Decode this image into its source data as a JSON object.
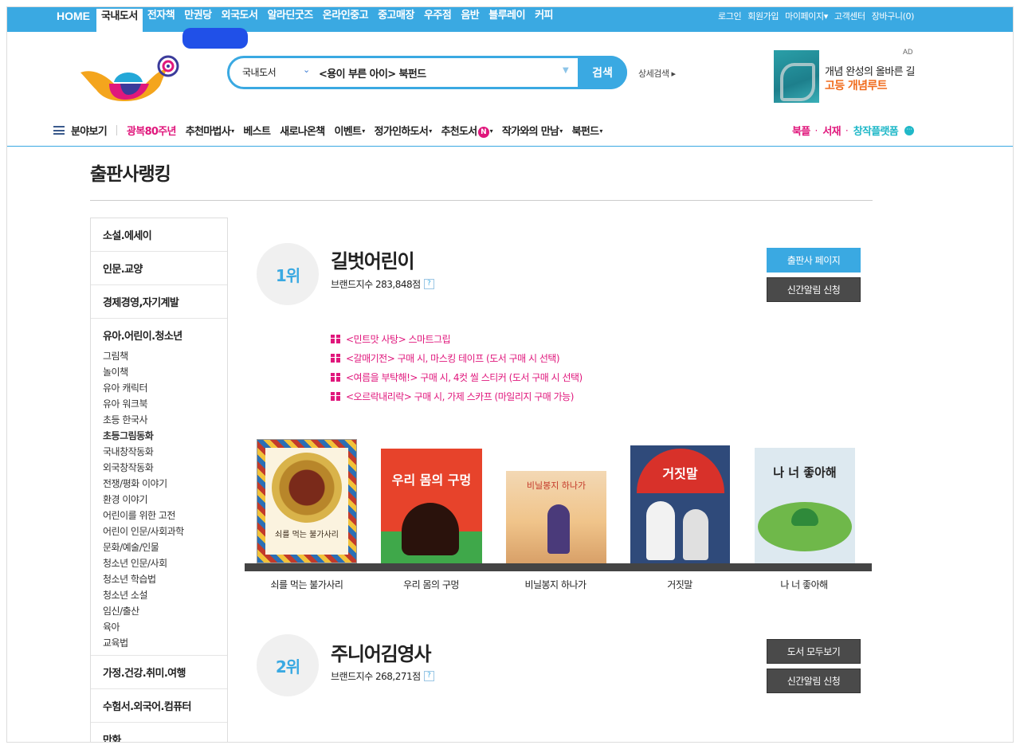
{
  "top_nav": {
    "items": [
      {
        "label": "HOME"
      },
      {
        "label": "국내도서"
      },
      {
        "label": "전자책"
      },
      {
        "label": "만권당"
      },
      {
        "label": "외국도서"
      },
      {
        "label": "알라딘굿즈"
      },
      {
        "label": "온라인중고"
      },
      {
        "label": "중고매장"
      },
      {
        "label": "우주점"
      },
      {
        "label": "음반"
      },
      {
        "label": "블루레이"
      },
      {
        "label": "커피"
      }
    ],
    "active": "국내도서",
    "util": [
      "로그인",
      "회원가입",
      "마이페이지▾",
      "고객센터",
      "장바구니(0)"
    ]
  },
  "search": {
    "category": "국내도서",
    "query": "<용이 부른 아이> 북펀드",
    "button_label": "검색",
    "advanced_label": "상세검색 ▸"
  },
  "ad": {
    "label": "AD",
    "line1": "개념 완성의 올바른 길",
    "line2": "고등 개념루트"
  },
  "gnb": {
    "menu_label": "분야보기",
    "items": [
      {
        "label": "광복80주년",
        "caret": ""
      },
      {
        "label": "추천마법사",
        "caret": "▾"
      },
      {
        "label": "베스트",
        "caret": ""
      },
      {
        "label": "새로나온책",
        "caret": ""
      },
      {
        "label": "이벤트",
        "caret": "▾"
      },
      {
        "label": "정가인하도서",
        "caret": "▾"
      },
      {
        "label": "추천도서",
        "caret": "▾"
      },
      {
        "label": "작가와의 만남",
        "caret": "▾"
      },
      {
        "label": "북펀드",
        "caret": "▾"
      }
    ],
    "new_badge": "N",
    "right": [
      {
        "label": "북플",
        "color": "#e0177c"
      },
      {
        "label": "서재",
        "color": "#e0177c"
      },
      {
        "label": "창작플랫폼",
        "color": "#20b8c8"
      }
    ],
    "dot": "·",
    "more_icon": "···"
  },
  "page_title": "출판사랭킹",
  "sidebar": {
    "categories": [
      {
        "label": "소설.에세이"
      },
      {
        "label": "인문.교양"
      },
      {
        "label": "경제경영,자기계발"
      },
      {
        "label": "유아.어린이.청소년",
        "subs": [
          "그림책",
          "놀이책",
          "유아 캐릭터",
          "유아 워크북",
          "초등 한국사",
          "초등그림동화",
          "국내창작동화",
          "외국창작동화",
          "전쟁/평화 이야기",
          "환경 이야기",
          "어린이를 위한 고전",
          "어린이 인문/사회과학",
          "문화/예술/인물",
          "청소년 인문/사회",
          "청소년 학습법",
          "청소년 소설",
          "임신/출산",
          "육아",
          "교육법"
        ],
        "bold_sub": "초등그림동화"
      },
      {
        "label": "가정.건강.취미.여행"
      },
      {
        "label": "수험서.외국어.컴퓨터"
      },
      {
        "label": "만화"
      }
    ]
  },
  "rankings": [
    {
      "rank": "1위",
      "name": "길벗어린이",
      "brand_index": "브랜드지수 283,848점",
      "help": "?",
      "buttons": [
        "출판사 페이지",
        "신간알림 신청"
      ],
      "promos": [
        "<민트맛 사탕> 스마트그립",
        "<갈매기전> 구매 시, 마스킹 테이프 (도서 구매 시 선택)",
        "<여름을 부탁해!> 구매 시, 4컷 씰 스티커 (도서 구매 시 선택)",
        "<오르락내리락> 구매 시, 가제 스카프 (마일리지 구매 가능)"
      ],
      "books": [
        {
          "title": "쇠를 먹는 불가사리",
          "cover_text": "쇠를 먹는 불가사리"
        },
        {
          "title": "우리 몸의 구멍",
          "cover_text": "우리 몸의 구멍"
        },
        {
          "title": "비닐봉지 하나가",
          "cover_text": "비닐봉지 하나가"
        },
        {
          "title": "거짓말",
          "cover_text": "거짓말"
        },
        {
          "title": "나 너 좋아해",
          "cover_text": "나 너 좋아해"
        }
      ]
    },
    {
      "rank": "2위",
      "name": "주니어김영사",
      "brand_index": "브랜드지수 268,271점",
      "help": "?",
      "buttons": [
        "도서 모두보기",
        "신간알림 신청"
      ]
    }
  ],
  "colors": {
    "accent": "#3aa9e2",
    "pink": "#e0177c",
    "teal": "#20b8c8",
    "orange": "#f06c1d"
  }
}
